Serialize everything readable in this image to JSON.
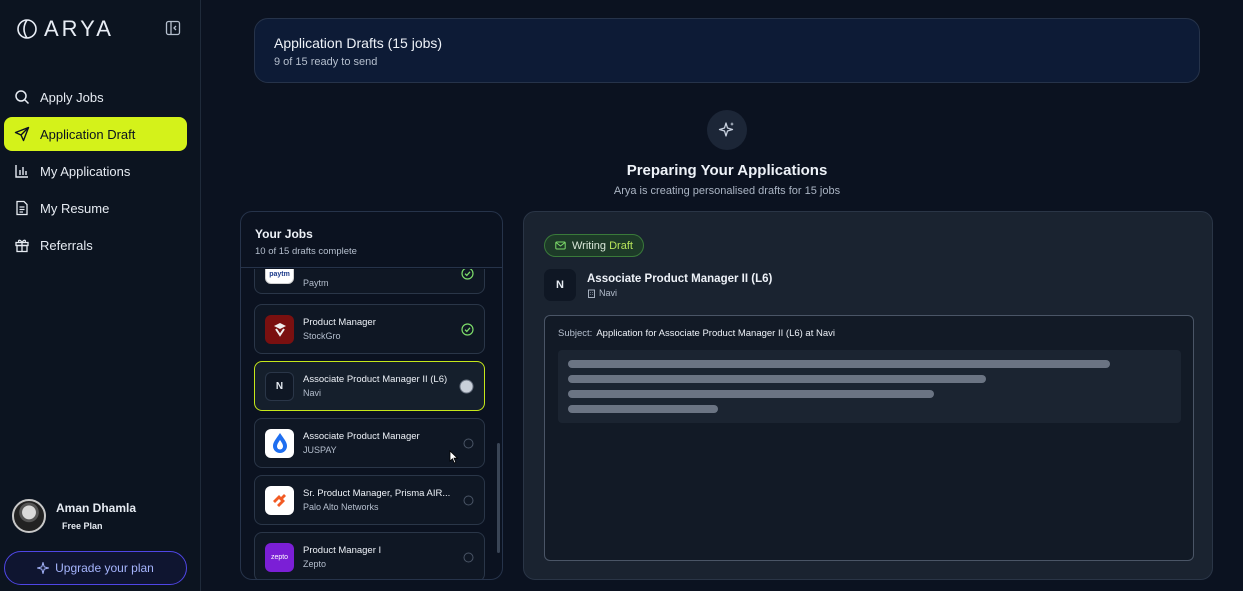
{
  "sidebar": {
    "logo_text": "ARYA",
    "nav": [
      {
        "label": "Apply Jobs",
        "icon": "search-icon",
        "active": false
      },
      {
        "label": "Application Draft",
        "icon": "send-icon",
        "active": true
      },
      {
        "label": "My Applications",
        "icon": "bar-chart-icon",
        "active": false
      },
      {
        "label": "My Resume",
        "icon": "document-icon",
        "active": false
      },
      {
        "label": "Referrals",
        "icon": "gift-icon",
        "active": false
      }
    ],
    "user": {
      "name": "Aman Dhamla",
      "plan": "Free Plan"
    },
    "upgrade_label": "Upgrade your plan"
  },
  "banner": {
    "title": "Application Drafts (15 jobs)",
    "subtitle": "9 of 15 ready to send"
  },
  "preparing": {
    "title": "Preparing Your Applications",
    "subtitle": "Arya is creating personalised drafts for 15 jobs"
  },
  "jobs_panel": {
    "title": "Your Jobs",
    "subtitle": "10 of 15 drafts complete",
    "jobs": [
      {
        "title": "",
        "company": "Paytm",
        "logo_text": "paytm",
        "logo_bg": "#ffffff",
        "logo_fg": "#1b3a8a",
        "status": "done"
      },
      {
        "title": "Product Manager",
        "company": "StockGro",
        "logo_text": "",
        "logo_bg": "#7a1010",
        "logo_fg": "#ffffff",
        "status": "done"
      },
      {
        "title": "Associate Product Manager II (L6)",
        "company": "Navi",
        "logo_text": "N",
        "logo_bg": "#0f1724",
        "logo_fg": "#e6ebf2",
        "status": "in-progress"
      },
      {
        "title": "Associate Product Manager",
        "company": "JUSPAY",
        "logo_text": "",
        "logo_bg": "#ffffff",
        "logo_fg": "#1e6ef0",
        "status": "pending"
      },
      {
        "title": "Sr. Product Manager, Prisma AIR...",
        "company": "Palo Alto Networks",
        "logo_text": "",
        "logo_bg": "#ffffff",
        "logo_fg": "#f25b24",
        "status": "pending"
      },
      {
        "title": "Product Manager I",
        "company": "Zepto",
        "logo_text": "zepto",
        "logo_bg": "#7b1fd6",
        "logo_fg": "#ffffff",
        "status": "pending"
      }
    ]
  },
  "draft": {
    "badge_prefix": "Writing",
    "badge_accent": "Draft",
    "logo_text": "N",
    "title": "Associate Product Manager II (L6)",
    "company": "Navi",
    "subject_label": "Subject:",
    "subject": "Application for Associate Product Manager II (L6) at Navi"
  },
  "colors": {
    "accent": "#d4f21a",
    "background": "#0b1220",
    "done": "#7ddc6a",
    "upgrade": "#4f46e5"
  }
}
